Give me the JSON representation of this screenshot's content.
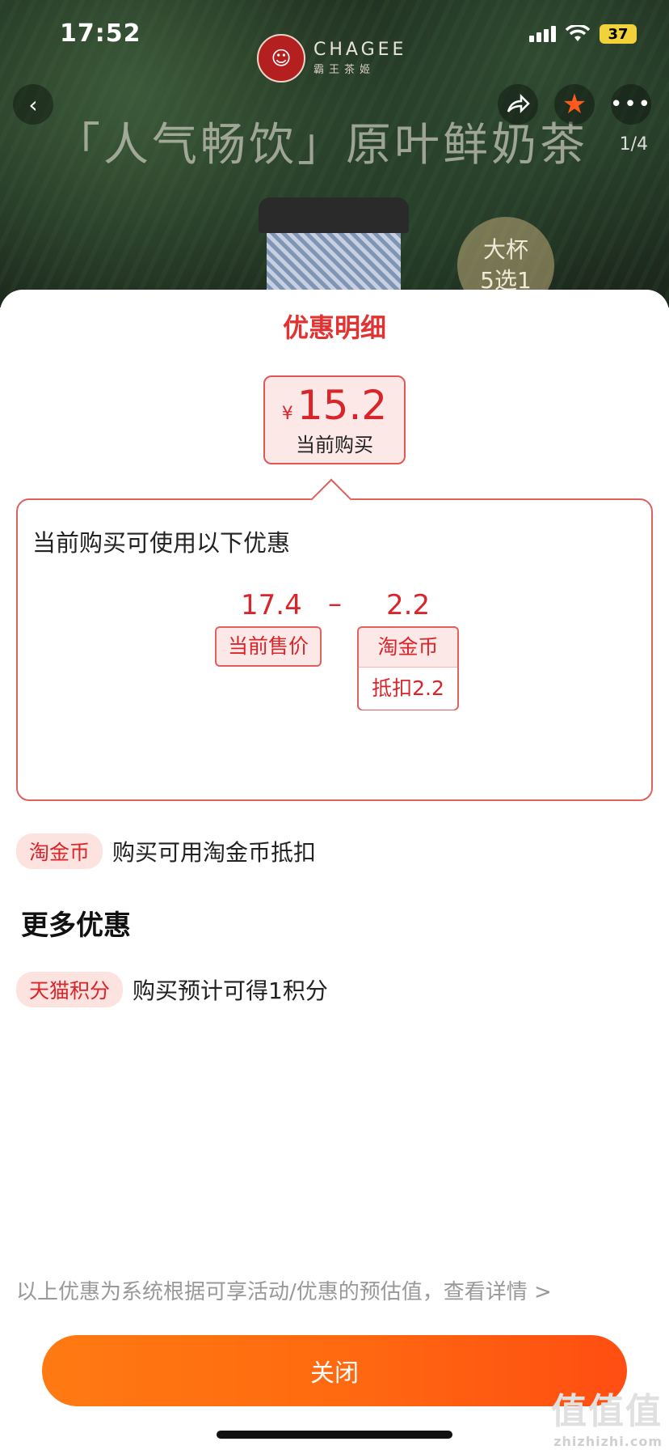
{
  "status_bar": {
    "time": "17:52",
    "battery": "37"
  },
  "brand": {
    "name": "CHAGEE",
    "name_cn": "霸王茶姬"
  },
  "hero": {
    "title": "「人气畅饮」原叶鲜奶茶",
    "page_indicator": "1/4",
    "seal_line1": "大杯",
    "seal_line2": "5选1"
  },
  "sheet": {
    "title": "优惠明细",
    "price": {
      "currency": "¥",
      "value": "15.2",
      "label": "当前购买"
    },
    "detail": {
      "heading": "当前购买可使用以下优惠",
      "original_price": "17.4",
      "operator": "–",
      "discount": "2.2",
      "original_label": "当前售价",
      "discount_label": "淘金币",
      "discount_sub": "抵扣2.2"
    },
    "coin_row": {
      "tag": "淘金币",
      "text": "购买可用淘金币抵扣"
    },
    "more": {
      "title": "更多优惠",
      "points_row": {
        "tag": "天猫积分",
        "text": "购买预计可得1积分"
      }
    },
    "footnote": "以上优惠为系统根据可享活动/优惠的预估值，查看详情 >",
    "close_label": "关闭"
  },
  "watermark": {
    "text": "值值值",
    "domain": "zhizhizhi.com"
  },
  "colors": {
    "accent": "#e23232",
    "button_start": "#ff7a12",
    "button_end": "#ff4e12"
  }
}
